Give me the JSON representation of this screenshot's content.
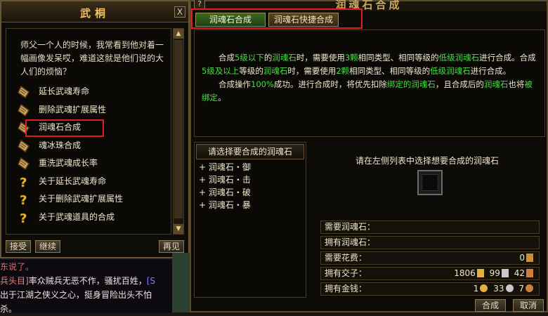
{
  "npc_dialog": {
    "title": "武桐",
    "intro": "师父一个人的时候，我常看到他对着一幅画像发呆哎，难道这就是他们说的大人们的烦恼？",
    "options": [
      {
        "label": "延长武魂寿命",
        "icon": "scroll-icon"
      },
      {
        "label": "删除武魂扩展属性",
        "icon": "scroll-icon"
      },
      {
        "label": "润魂石合成",
        "icon": "scroll-icon",
        "highlighted": true
      },
      {
        "label": "魂冰珠合成",
        "icon": "scroll-icon"
      },
      {
        "label": "重洗武魂成长率",
        "icon": "scroll-icon"
      },
      {
        "label": "关于延长武魂寿命",
        "icon": "question-icon"
      },
      {
        "label": "关于删除武魂扩展属性",
        "icon": "question-icon"
      },
      {
        "label": "关于武魂道具的合成",
        "icon": "question-icon"
      }
    ],
    "buttons": {
      "accept": "接受",
      "continue": "继续",
      "goodbye": "再见"
    },
    "help": "?",
    "close": "X"
  },
  "chat": {
    "line1": "东说了。",
    "line2_prefix": "兵头目]",
    "line2": "率众贼兵无恶不作，骚扰百姓，",
    "line2_link": "[S",
    "line3": "出于江湖之侠义之心，挺身冒险出头不怕",
    "line4": "杀。"
  },
  "compose": {
    "title": "润魂石合成",
    "help": "?",
    "tabs": [
      "润魂石合成",
      "润魂石快捷合成"
    ],
    "description": [
      [
        "合成",
        "5级以下",
        "的",
        "润魂石",
        "时，需要使用",
        "3颗",
        "相同类型、相同等级的",
        "低级润魂石",
        "进行合成。合成",
        "5级及以上",
        "等级的",
        "润魂石",
        "时，需要使用",
        "2颗",
        "相同类型、相同等级的",
        "低级润魂石",
        "进行合成。"
      ],
      [
        "合成操作",
        "100%",
        "成功。进行合成时，将优先扣除",
        "绑定的润魂石",
        "，且合成后的",
        "润魂石",
        "也将",
        "被绑定",
        "。"
      ]
    ],
    "list_header": "请选择要合成的润魂石",
    "list_items": [
      "+ 润魂石・御",
      "+ 润魂石・击",
      "+ 润魂石・破",
      "+ 润魂石・暴"
    ],
    "hint": "请在左侧列表中选择想要合成的润魂石",
    "rows": {
      "need_stone": "需要润魂石：",
      "own_stone": "拥有润魂石：",
      "cost": "需要花费：",
      "cost_value": "0",
      "jiaozi": "拥有交子：",
      "jiaozi_gold": "1806",
      "jiaozi_silver": "99",
      "jiaozi_copper": "42",
      "money": "拥有金钱：",
      "money_gold": "1",
      "money_silver": "33",
      "money_copper": "7"
    },
    "buttons": {
      "compose": "合成",
      "cancel": "取消"
    }
  },
  "colors": {
    "highlight": "#e02020",
    "green_text": "#40e040",
    "gold": "#f0c060"
  }
}
